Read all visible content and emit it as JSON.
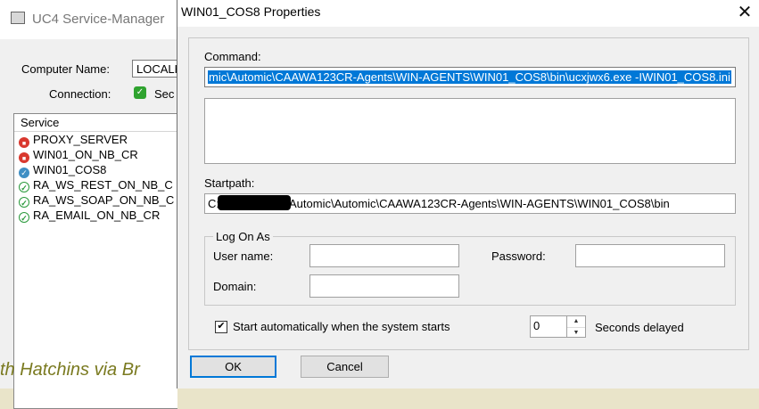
{
  "background_window": {
    "title": "UC4 Service-Manager",
    "computer_name_label": "Computer Name:",
    "computer_name_value": "LOCALH",
    "connection_label": "Connection:",
    "connection_value": "Sec",
    "service_header": "Service",
    "services": [
      {
        "name": "PROXY_SERVER",
        "status": "stopped"
      },
      {
        "name": "WIN01_ON_NB_CR",
        "status": "stopped"
      },
      {
        "name": "WIN01_COS8",
        "status": "pending"
      },
      {
        "name": "RA_WS_REST_ON_NB_C",
        "status": "running"
      },
      {
        "name": "RA_WS_SOAP_ON_NB_C",
        "status": "running"
      },
      {
        "name": "RA_EMAIL_ON_NB_CR",
        "status": "running"
      }
    ],
    "behind_text": "th Hatchins via Br"
  },
  "dialog": {
    "title": "WIN01_COS8 Properties",
    "close_icon": "close-icon",
    "command_label": "Command:",
    "command_value": "mic\\Automic\\CAAWA123CR-Agents\\WIN-AGENTS\\WIN01_COS8\\bin\\ucxjwx6.exe -IWIN01_COS8.ini",
    "startpath_label": "Startpath:",
    "startpath_prefix": "C:",
    "startpath_suffix": "Automic\\Automic\\CAAWA123CR-Agents\\WIN-AGENTS\\WIN01_COS8\\bin",
    "logon_group_label": "Log On As",
    "username_label": "User name:",
    "username_value": "",
    "password_label": "Password:",
    "password_value": "",
    "domain_label": "Domain:",
    "domain_value": "",
    "autostart_label": "Start automatically when the system starts",
    "autostart_checked": true,
    "delay_value": "0",
    "delay_label": "Seconds delayed",
    "ok_label": "OK",
    "cancel_label": "Cancel"
  }
}
